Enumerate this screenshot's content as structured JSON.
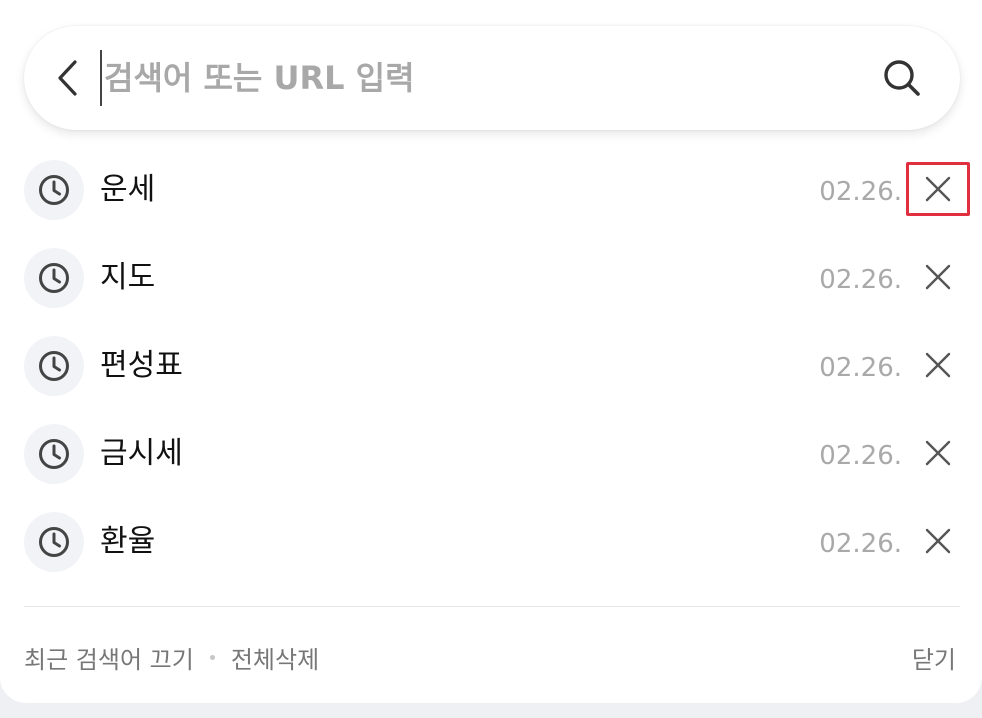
{
  "search": {
    "placeholder": "검색어 또는 URL 입력",
    "value": ""
  },
  "history": [
    {
      "label": "운세",
      "date": "02.26."
    },
    {
      "label": "지도",
      "date": "02.26."
    },
    {
      "label": "편성표",
      "date": "02.26."
    },
    {
      "label": "금시세",
      "date": "02.26."
    },
    {
      "label": "환율",
      "date": "02.26."
    }
  ],
  "footer": {
    "turn_off_label": "최근 검색어 끄기",
    "delete_all_label": "전체삭제",
    "close_label": "닫기"
  },
  "colors": {
    "highlight_border": "#e0303f",
    "date_text": "#a9a9a9",
    "icon_bg": "#f1f3f6"
  },
  "icons": {
    "back": "chevron-left-icon",
    "search": "search-icon",
    "history": "clock-icon",
    "delete": "close-icon"
  }
}
